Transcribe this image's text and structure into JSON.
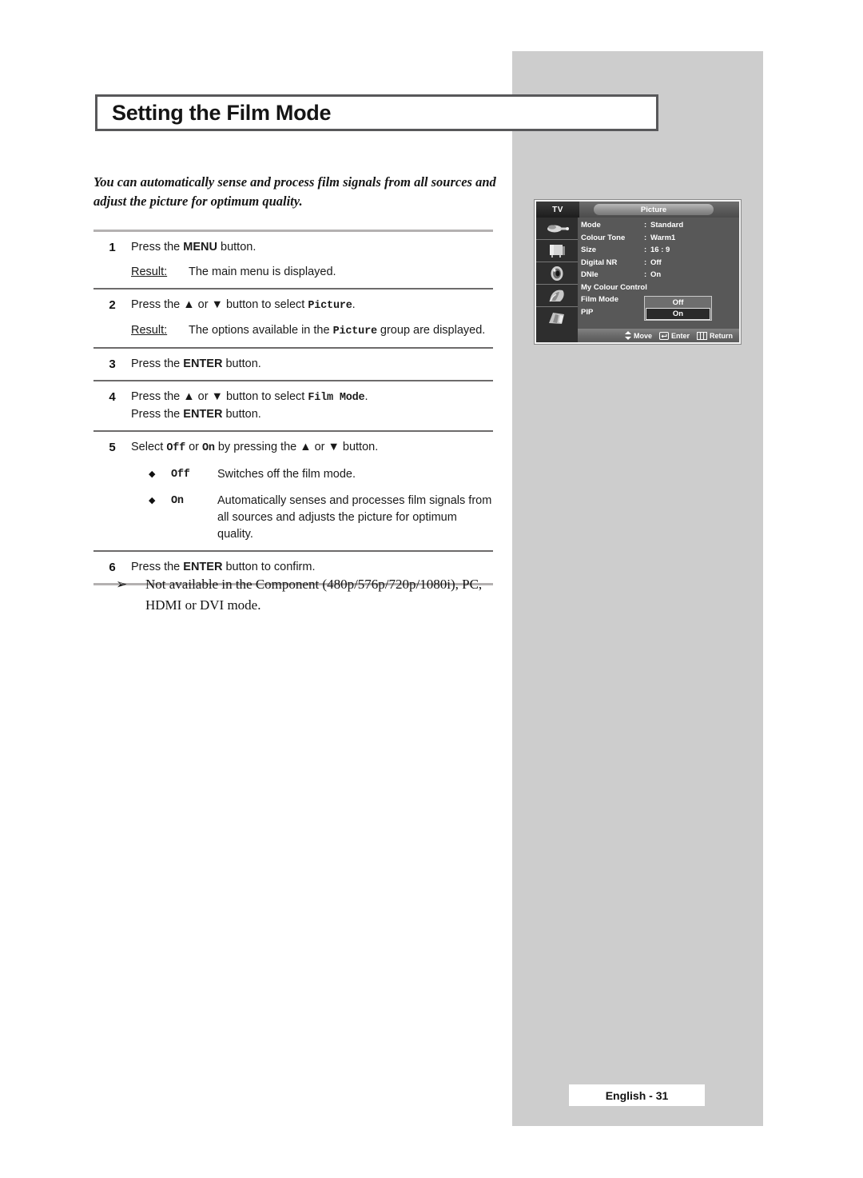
{
  "page": {
    "title": "Setting the Film Mode",
    "intro": "You can automatically sense and process film signals from all sources and adjust the picture for optimum quality.",
    "footer_label": "English - 31"
  },
  "steps": [
    {
      "number": "1",
      "lines": [
        {
          "pre": "Press the ",
          "strong": "MENU",
          "post": " button."
        }
      ],
      "result": {
        "label": "Result:",
        "text": "The main menu is displayed."
      }
    },
    {
      "number": "2",
      "lines": [
        {
          "pre": "Press the ▲ or ▼ button to select ",
          "mono": "Picture",
          "post": "."
        }
      ],
      "result": {
        "label": "Result:",
        "pre": "The options available in the ",
        "mono": "Picture",
        "post": " group are displayed."
      }
    },
    {
      "number": "3",
      "lines": [
        {
          "pre": "Press the ",
          "strong": "ENTER",
          "post": " button."
        }
      ]
    },
    {
      "number": "4",
      "lines": [
        {
          "pre": "Press the ▲ or ▼ button to select ",
          "mono": "Film Mode",
          "post": "."
        },
        {
          "pre": "Press the ",
          "strong": "ENTER",
          "post": " button."
        }
      ]
    },
    {
      "number": "5",
      "lines": [
        {
          "pre": "Select ",
          "mono": "Off",
          "mid": " or ",
          "mono2": "On",
          "post": "  by pressing the ▲ or ▼ button."
        }
      ],
      "bullets": [
        {
          "mark": "◆",
          "key": "Off",
          "desc": "Switches off the film mode."
        },
        {
          "mark": "◆",
          "key": "On",
          "desc": "Automatically senses and processes film signals from all sources and adjusts the picture for optimum quality."
        }
      ]
    },
    {
      "number": "6",
      "lines": [
        {
          "pre": "Press the ",
          "strong": "ENTER",
          "post": " button to confirm."
        }
      ]
    }
  ],
  "note": {
    "mark": "➢",
    "text": "Not available in the Component (480p/576p/720p/1080i), PC, HDMI or DVI mode."
  },
  "osd": {
    "source_label": "TV",
    "menu_title": "Picture",
    "items": [
      {
        "label": "Mode",
        "colon": ":",
        "value": "Standard"
      },
      {
        "label": "Colour Tone",
        "colon": ":",
        "value": "Warm1"
      },
      {
        "label": "Size",
        "colon": ":",
        "value": "16 : 9"
      },
      {
        "label": "Digital NR",
        "colon": ":",
        "value": "Off"
      },
      {
        "label": "DNIe",
        "colon": ":",
        "value": "On"
      },
      {
        "label": "My Colour Control",
        "colon": "",
        "value": ""
      },
      {
        "label": "Film Mode",
        "colon": ":",
        "value": ""
      },
      {
        "label": "PIP",
        "colon": "",
        "value": ""
      }
    ],
    "popup": {
      "option_off": "Off",
      "option_on": "On"
    },
    "footer": [
      {
        "glyph": "updown-arrow-icon",
        "label": "Move"
      },
      {
        "glyph": "enter-icon",
        "label": "Enter"
      },
      {
        "glyph": "return-icon",
        "label": "Return"
      }
    ],
    "icon_names": [
      "input-source-icon",
      "tv-set-icon",
      "sound-speaker-icon",
      "setup-icon",
      "pip-icon"
    ]
  },
  "colors": {
    "panel_gray": "#cdcdcd",
    "title_border": "#58585a",
    "rule_light": "#b4b1b1",
    "rule_dark": "#6d6b6b",
    "osd_background": "#585858"
  }
}
